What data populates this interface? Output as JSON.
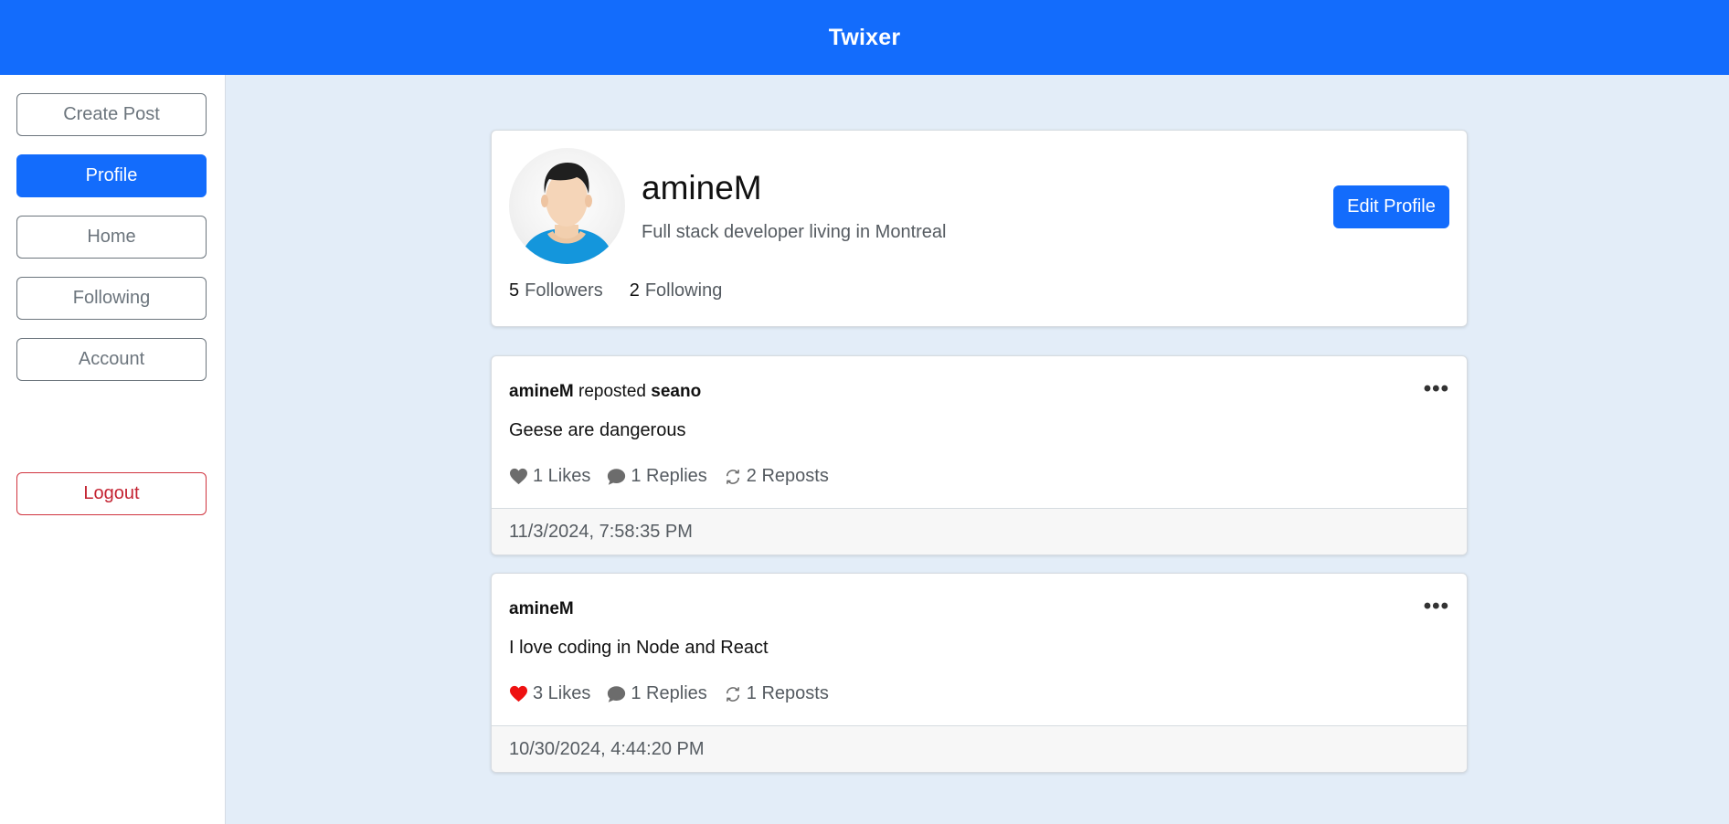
{
  "header": {
    "title": "Twixer"
  },
  "sidebar": {
    "items": [
      {
        "label": "Create Post"
      },
      {
        "label": "Profile"
      },
      {
        "label": "Home"
      },
      {
        "label": "Following"
      },
      {
        "label": "Account"
      }
    ],
    "logout_label": "Logout"
  },
  "profile": {
    "username": "amineM",
    "bio": "Full stack developer living in Montreal",
    "edit_label": "Edit Profile",
    "followers_count": "5",
    "followers_label": "Followers",
    "following_count": "2",
    "following_label": "Following"
  },
  "posts": [
    {
      "author": "amineM",
      "repost_word": "reposted",
      "original_author": "seano",
      "text": "Geese are dangerous",
      "likes": "1 Likes",
      "liked": false,
      "replies": "1 Replies",
      "reposts": "2 Reposts",
      "timestamp": "11/3/2024, 7:58:35 PM"
    },
    {
      "author": "amineM",
      "text": "I love coding in Node and React",
      "likes": "3 Likes",
      "liked": true,
      "replies": "1 Replies",
      "reposts": "1 Reposts",
      "timestamp": "10/30/2024, 4:44:20 PM"
    }
  ],
  "icons": {
    "menu": "ellipsis-icon",
    "like": "heart-icon",
    "reply": "chat-bubble-icon",
    "repost": "repost-arrows-icon"
  },
  "colors": {
    "primary": "#136cfc",
    "background": "#e3edf8",
    "danger": "#c42332",
    "liked_heart": "#ee1111",
    "muted_icon": "#6c6c6c"
  }
}
